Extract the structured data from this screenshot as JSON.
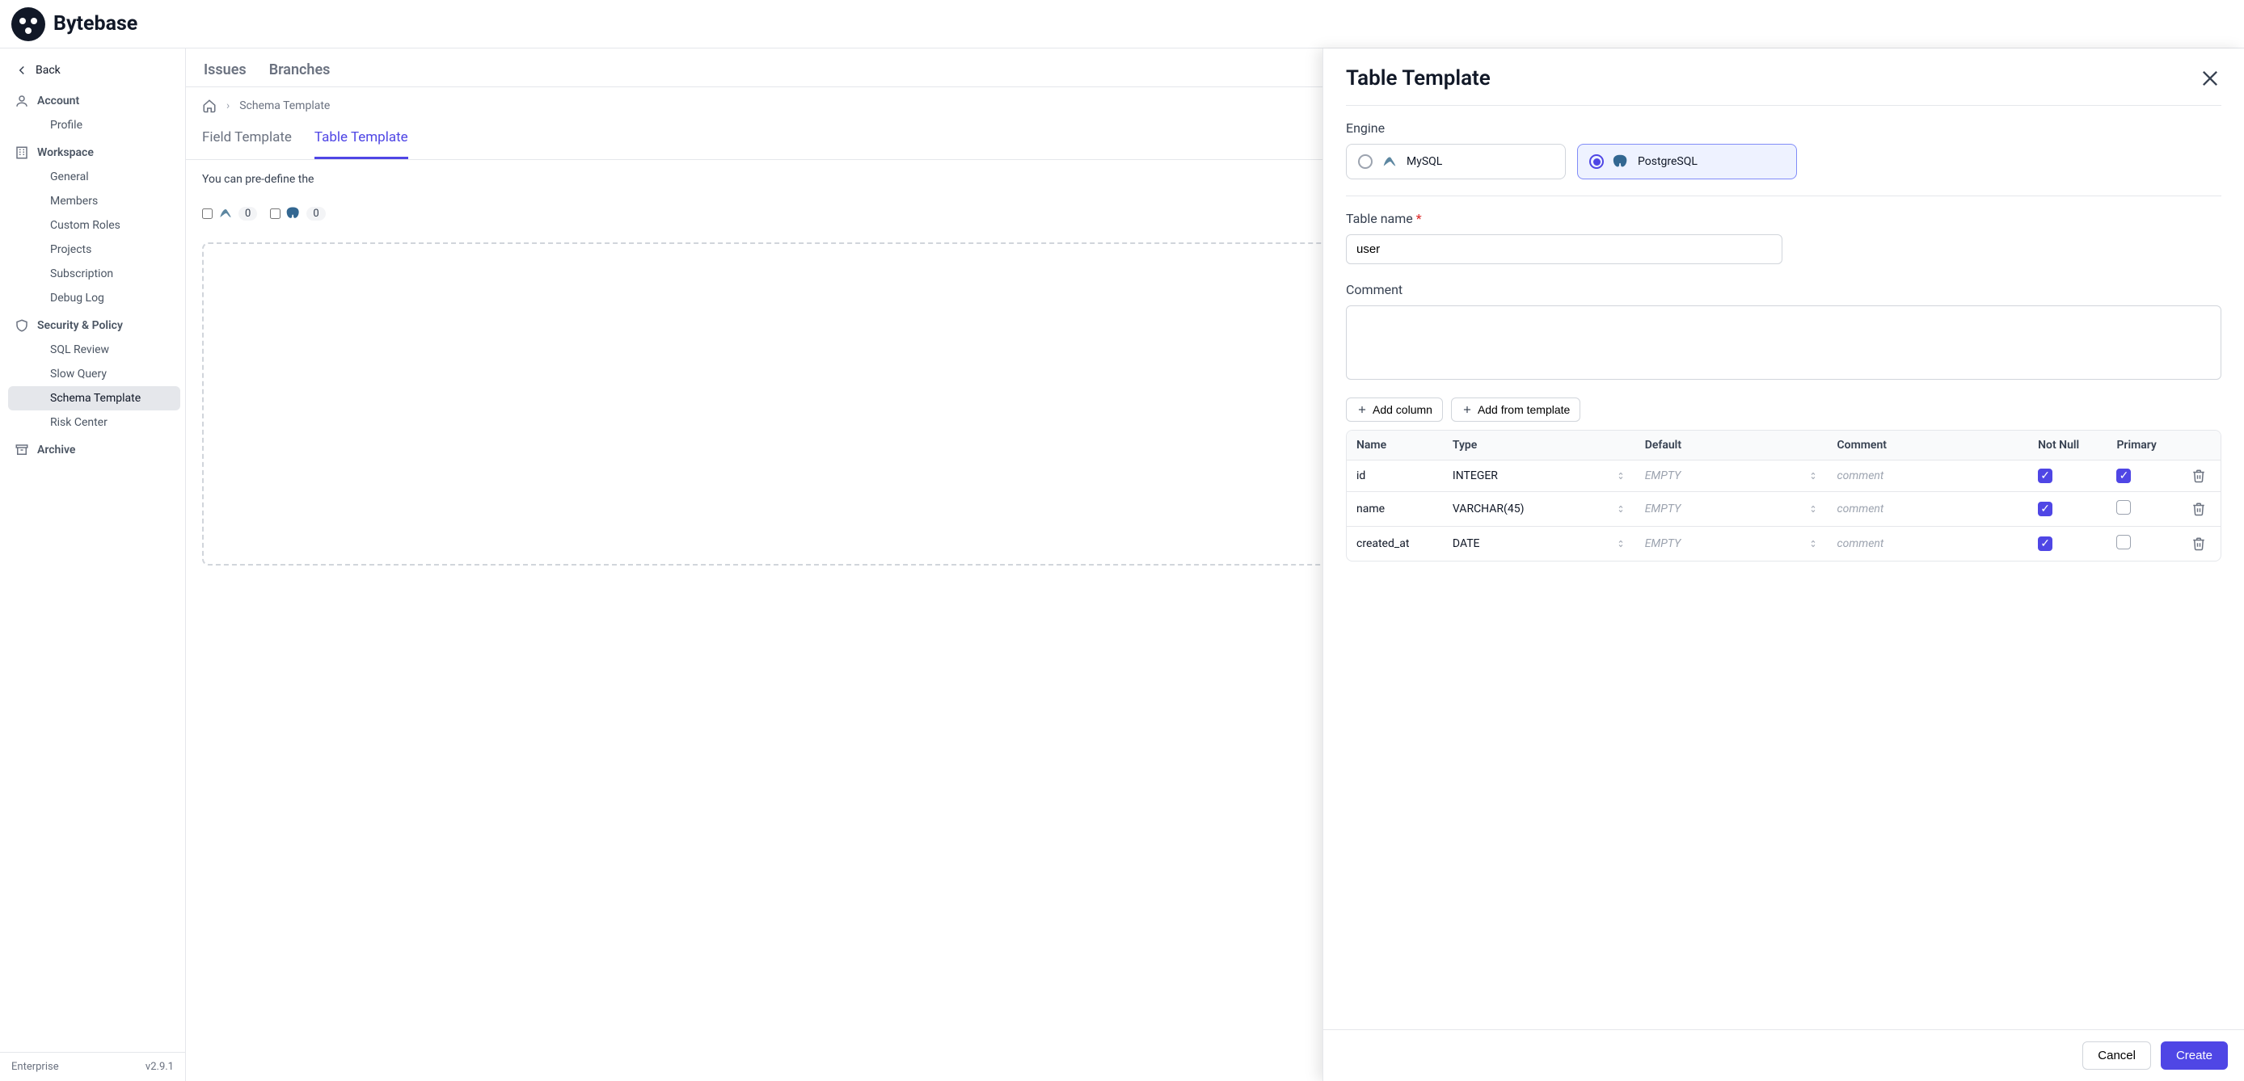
{
  "brand": "Bytebase",
  "sidebar": {
    "back": "Back",
    "sections": [
      {
        "title": "Account",
        "items": [
          "Profile"
        ]
      },
      {
        "title": "Workspace",
        "items": [
          "General",
          "Members",
          "Custom Roles",
          "Projects",
          "Subscription",
          "Debug Log"
        ]
      },
      {
        "title": "Security & Policy",
        "items": [
          "SQL Review",
          "Slow Query",
          "Schema Template",
          "Risk Center"
        ]
      }
    ],
    "archive": "Archive",
    "footer": {
      "plan": "Enterprise",
      "version": "v2.9.1"
    },
    "active_item": "Schema Template"
  },
  "header_tabs": [
    "Issues",
    "Branches"
  ],
  "breadcrumbs": {
    "current": "Schema Template"
  },
  "sub_tabs": {
    "items": [
      "Field Template",
      "Table Template"
    ],
    "active": "Table Template"
  },
  "main_blurb": "You can pre-define the",
  "counters": {
    "mysql": 0,
    "postgresql": 0
  },
  "panel": {
    "title": "Table Template",
    "engine": {
      "label": "Engine",
      "options": [
        {
          "id": "mysql",
          "label": "MySQL",
          "selected": false
        },
        {
          "id": "postgresql",
          "label": "PostgreSQL",
          "selected": true
        }
      ]
    },
    "table_name": {
      "label": "Table name",
      "value": "user"
    },
    "comment": {
      "label": "Comment",
      "value": ""
    },
    "buttons": {
      "add_column": "Add column",
      "add_from_template": "Add from template"
    },
    "columns_table": {
      "headers": [
        "Name",
        "Type",
        "Default",
        "Comment",
        "Not Null",
        "Primary",
        ""
      ],
      "rows": [
        {
          "name": "id",
          "type": "INTEGER",
          "default": "EMPTY",
          "comment": "comment",
          "not_null": true,
          "primary": true
        },
        {
          "name": "name",
          "type": "VARCHAR(45)",
          "default": "EMPTY",
          "comment": "comment",
          "not_null": true,
          "primary": false
        },
        {
          "name": "created_at",
          "type": "DATE",
          "default": "EMPTY",
          "comment": "comment",
          "not_null": true,
          "primary": false
        }
      ]
    },
    "footer": {
      "cancel": "Cancel",
      "create": "Create"
    }
  }
}
